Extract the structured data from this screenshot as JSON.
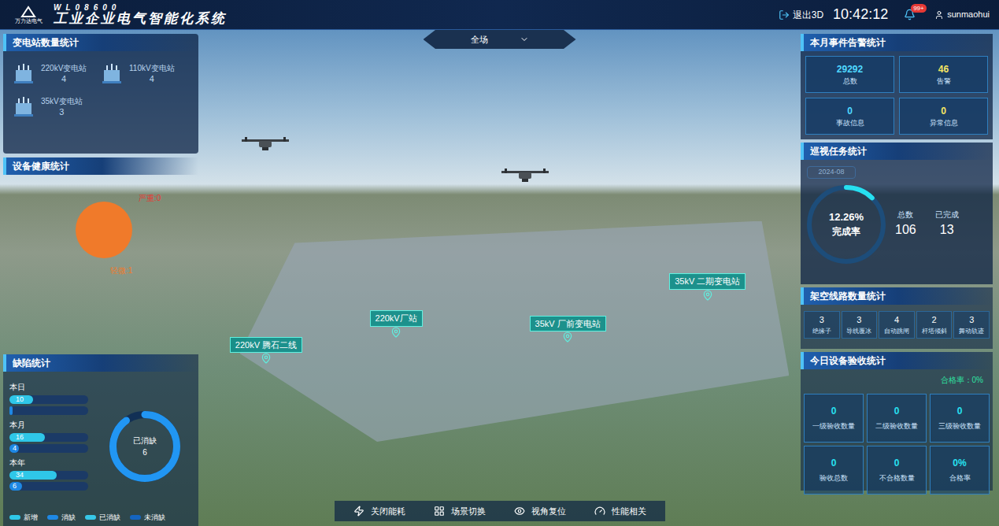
{
  "header": {
    "logo_code": "WL08600",
    "logo_brand": "万力达电气",
    "title": "工业企业电气智能化系统",
    "exit3d": "退出3D",
    "time": "10:42:12",
    "badge": "99+",
    "user": "sunmaohui"
  },
  "scope_select": {
    "value": "全场"
  },
  "substations": {
    "title": "变电站数量统计",
    "items": [
      {
        "label": "220kV变电站",
        "count": "4"
      },
      {
        "label": "110kV变电站",
        "count": "4"
      },
      {
        "label": "35kV变电站",
        "count": "3"
      }
    ]
  },
  "health": {
    "title": "设备健康统计",
    "slices": [
      {
        "label": "严重:0",
        "value": 0,
        "color": "#e53935"
      },
      {
        "label": "轻微:1",
        "value": 1,
        "color": "#f07a2a"
      }
    ]
  },
  "defects": {
    "title": "缺陷统计",
    "rows": [
      {
        "label": "本日",
        "added": "10",
        "added_level": 0.3,
        "cleared": "",
        "cleared_level": 0.04
      },
      {
        "label": "本月",
        "added": "16",
        "added_level": 0.45,
        "cleared": "4",
        "cleared_level": 0.12
      },
      {
        "label": "本年",
        "added": "34",
        "added_level": 0.6,
        "cleared": "6",
        "cleared_level": 0.16
      }
    ],
    "donut": {
      "label": "已消缺",
      "value": "6",
      "level": 0.9
    },
    "legend": [
      {
        "label": "新增",
        "color": "#2fc7e8"
      },
      {
        "label": "消缺",
        "color": "#1e88e5"
      },
      {
        "label": "已消缺",
        "color": "#37c7e8"
      },
      {
        "label": "未消缺",
        "color": "#1565c0"
      }
    ]
  },
  "alarms": {
    "title": "本月事件告警统计",
    "items": [
      {
        "value": "29292",
        "label": "总数",
        "color": "#4fd8ff"
      },
      {
        "value": "46",
        "label": "告警",
        "color": "#f5e663"
      },
      {
        "value": "0",
        "label": "事故信息",
        "color": "#4fd8ff"
      },
      {
        "value": "0",
        "label": "异常信息",
        "color": "#f5e663"
      }
    ]
  },
  "patrol": {
    "title": "巡视任务统计",
    "month": "2024-08",
    "rate": "12.26%",
    "rate_label": "完成率",
    "level": 0.1226,
    "total_label": "总数",
    "total": "106",
    "done_label": "已完成",
    "done": "13"
  },
  "lines": {
    "title": "架空线路数量统计",
    "items": [
      {
        "value": "3",
        "label": "绝缘子"
      },
      {
        "value": "3",
        "label": "导线覆冰"
      },
      {
        "value": "4",
        "label": "自动跳闸"
      },
      {
        "value": "2",
        "label": "杆塔倾斜"
      },
      {
        "value": "3",
        "label": "舞动轨迹"
      }
    ]
  },
  "acceptance": {
    "title": "今日设备验收统计",
    "pass_rate": "合格率：0%",
    "items": [
      {
        "value": "0",
        "label": "一级验收数量"
      },
      {
        "value": "0",
        "label": "二级验收数量"
      },
      {
        "value": "0",
        "label": "三级验收数量"
      },
      {
        "value": "0",
        "label": "验收总数"
      },
      {
        "value": "0",
        "label": "不合格数量"
      },
      {
        "value": "0%",
        "label": "合格率"
      }
    ]
  },
  "scene_labels": [
    {
      "label": "220kV厂站",
      "x": 37,
      "y": 59
    },
    {
      "label": "35kV 厂前变电站",
      "x": 53,
      "y": 60
    },
    {
      "label": "35kV 二期变电站",
      "x": 67,
      "y": 52
    },
    {
      "label": "220kV 腾石二线",
      "x": 23,
      "y": 64
    }
  ],
  "toolbar": [
    {
      "label": "关闭能耗"
    },
    {
      "label": "场景切换"
    },
    {
      "label": "视角复位"
    },
    {
      "label": "性能相关"
    }
  ]
}
